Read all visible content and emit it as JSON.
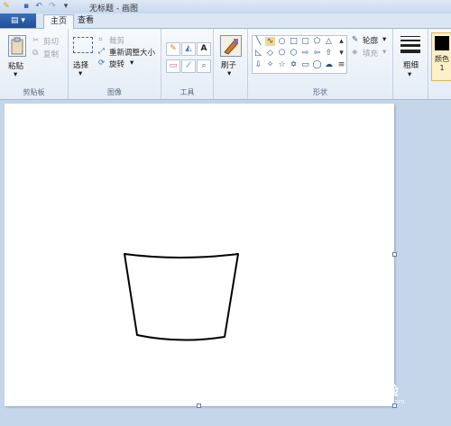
{
  "window": {
    "title": "无标题 - 画图"
  },
  "tabs": {
    "file": "▤ ▾",
    "home": "主页",
    "view": "查看"
  },
  "clipboard": {
    "paste": "粘贴",
    "cut": "剪切",
    "copy": "复制",
    "label": "剪贴板"
  },
  "image": {
    "select": "选择",
    "crop": "裁剪",
    "resize": "重新调整大小",
    "rotate": "旋转",
    "label": "图像"
  },
  "tools": {
    "label": "工具",
    "text_icon": "A"
  },
  "brushes": {
    "label": "刷子"
  },
  "shapes": {
    "outline": "轮廓",
    "fill": "填充",
    "label": "形状"
  },
  "size": {
    "label": "粗细"
  },
  "colors": {
    "color1": "颜色1",
    "color1_value": "#000000"
  },
  "watermark": {
    "text": "Bai 经验",
    "sub": "jingyan.baidu.com"
  }
}
